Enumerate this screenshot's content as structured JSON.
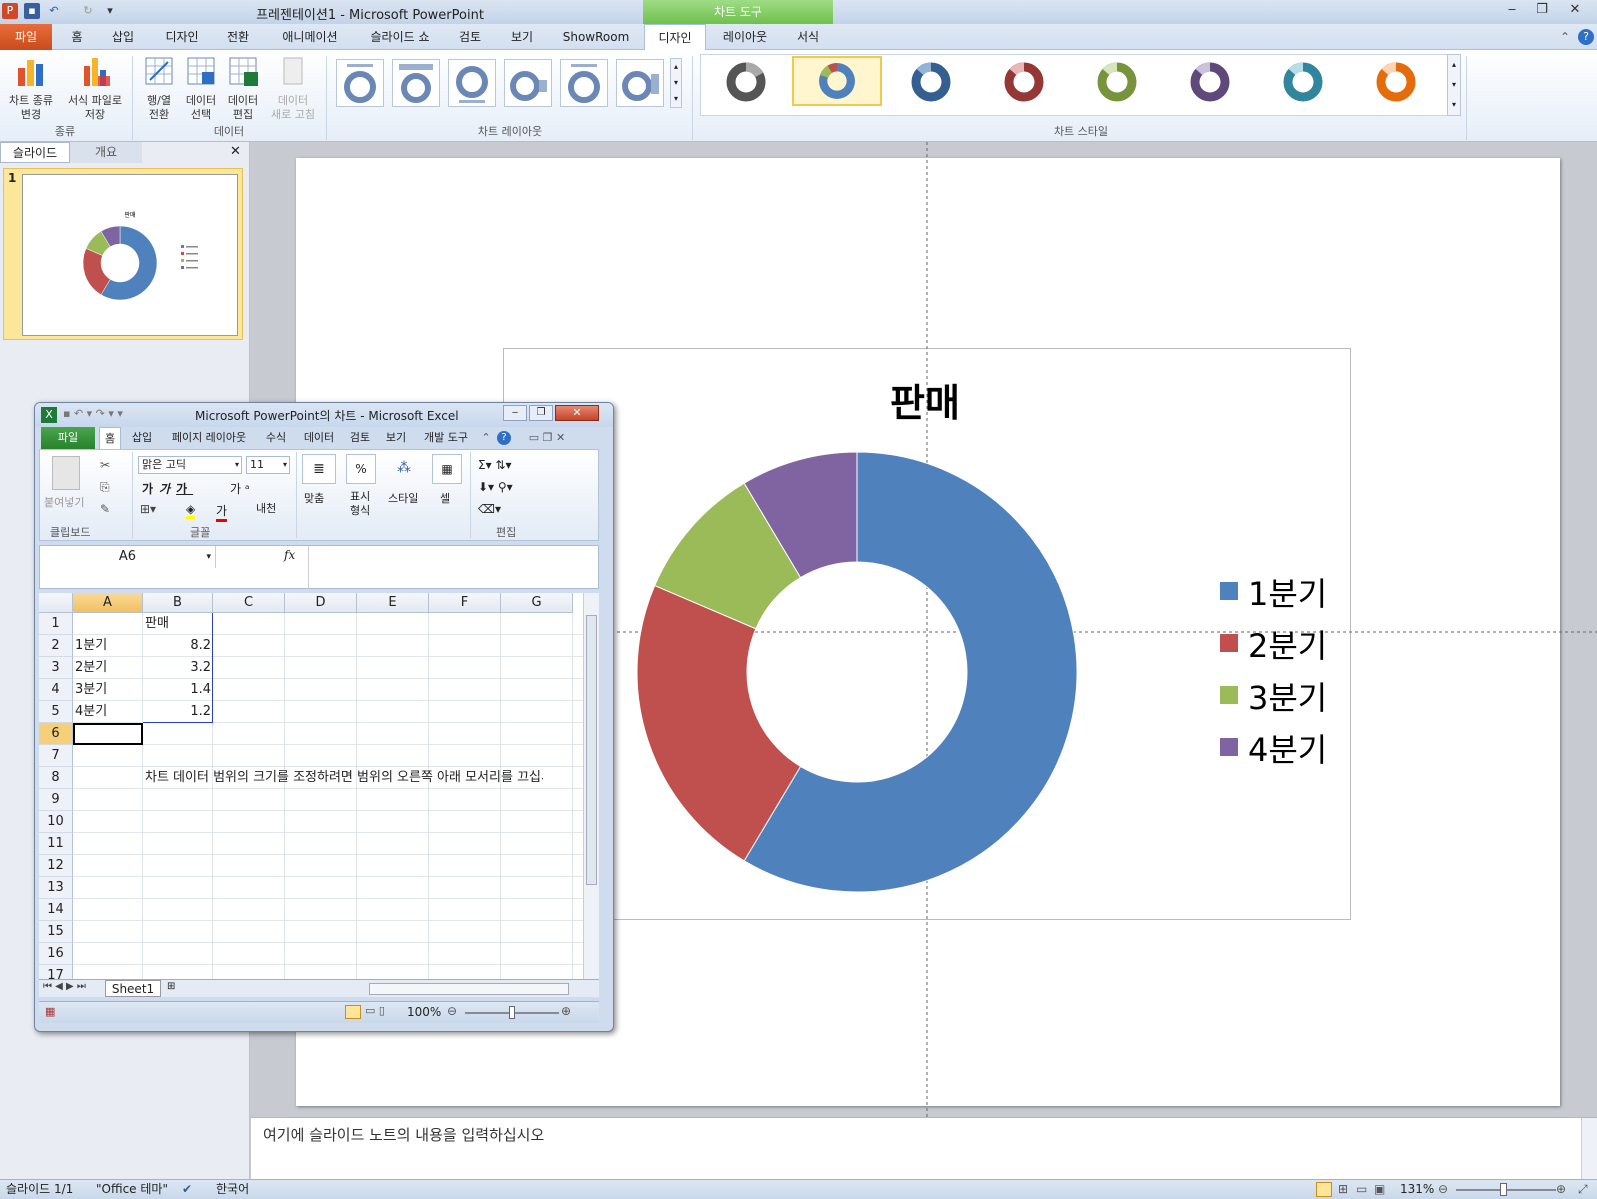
{
  "app": {
    "title": "프레젠테이션1 - Microsoft PowerPoint",
    "context_tab_group": "차트 도구"
  },
  "tabs": [
    "파일",
    "홈",
    "삽입",
    "디자인",
    "전환",
    "애니메이션",
    "슬라이드 쇼",
    "검토",
    "보기",
    "ShowRoom",
    "디자인",
    "레이아웃",
    "서식"
  ],
  "ribbon": {
    "type_group": {
      "label": "종류",
      "buttons": [
        {
          "label1": "차트 종류",
          "label2": "변경"
        },
        {
          "label1": "서식 파일로",
          "label2": "저장"
        }
      ]
    },
    "data_group": {
      "label": "데이터",
      "buttons": [
        {
          "label1": "행/열",
          "label2": "전환"
        },
        {
          "label1": "데이터",
          "label2": "선택"
        },
        {
          "label1": "데이터",
          "label2": "편집"
        },
        {
          "label1": "데이터",
          "label2": "새로 고침"
        }
      ]
    },
    "layout_group": {
      "label": "차트 레이아웃"
    },
    "style_group": {
      "label": "차트 스타일"
    }
  },
  "left_pane": {
    "tabs": [
      "슬라이드",
      "개요"
    ],
    "slide_number": "1"
  },
  "chart_data": {
    "type": "donut",
    "title": "판매",
    "categories": [
      "1분기",
      "2분기",
      "3분기",
      "4분기"
    ],
    "values": [
      8.2,
      3.2,
      1.4,
      1.2
    ],
    "colors": [
      "#4f81bd",
      "#c0504d",
      "#9bbb59",
      "#8064a2"
    ],
    "legend_position": "right"
  },
  "excel": {
    "title": "Microsoft PowerPoint의 차트 - Microsoft Excel",
    "tabs": [
      "파일",
      "홈",
      "삽입",
      "페이지 레이아웃",
      "수식",
      "데이터",
      "검토",
      "보기",
      "개발 도구"
    ],
    "font_name": "맑은 고딕",
    "font_size": "11",
    "group_labels": {
      "clipboard": "클립보드",
      "font": "글꼴",
      "edit": "편집"
    },
    "buttons": {
      "paste": "붙여넣기",
      "align": "맞춤",
      "number1": "표시",
      "number2": "형식",
      "style": "스타일",
      "cell": "셀"
    },
    "name_box": "A6",
    "fx": "fx",
    "columns": [
      "A",
      "B",
      "C",
      "D",
      "E",
      "F",
      "G"
    ],
    "rows": [
      "1",
      "2",
      "3",
      "4",
      "5",
      "6",
      "7",
      "8",
      "9",
      "10",
      "11",
      "12",
      "13",
      "14",
      "15",
      "16",
      "17"
    ],
    "header_b1": "판매",
    "data_rows": [
      {
        "label": "1분기",
        "value": "8.2"
      },
      {
        "label": "2분기",
        "value": "3.2"
      },
      {
        "label": "3분기",
        "value": "1.4"
      },
      {
        "label": "4분기",
        "value": "1.2"
      }
    ],
    "note": "차트 데이터 범위의 크기를 조정하려면 범위의 오른쪽 아래 모서리를 끄십시오.",
    "sheet_tab": "Sheet1",
    "zoom": "100%"
  },
  "notes_placeholder": "여기에 슬라이드 노트의 내용을 입력하십시오",
  "status": {
    "slide": "슬라이드 1/1",
    "theme": "\"Office 테마\"",
    "lang": "한국어",
    "zoom": "131%"
  }
}
